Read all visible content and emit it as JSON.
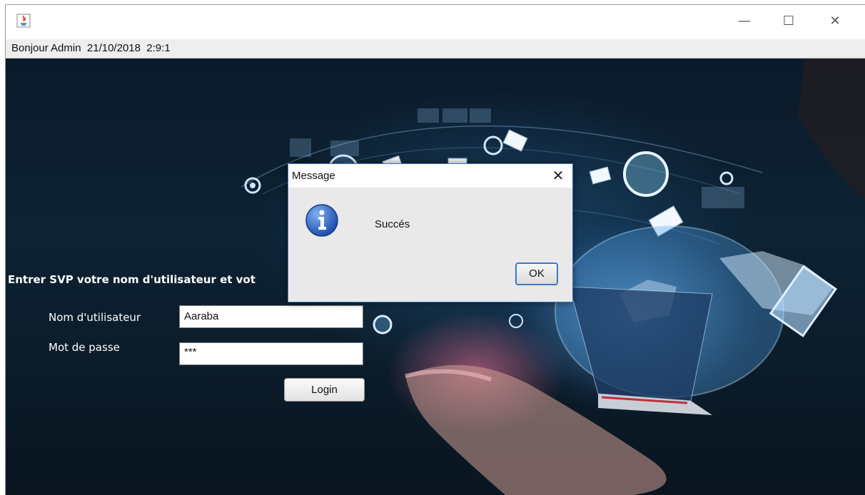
{
  "window": {
    "title": "",
    "controls": {
      "minimize": "—",
      "maximize": "☐",
      "close": "✕"
    },
    "status": "Bonjour Admin  21/10/2018  2:9:1"
  },
  "login": {
    "prompt": "Entrer SVP votre nom d'utilisateur et vot",
    "username_label": "Nom d'utilisateur",
    "username_value": "Aaraba",
    "password_label": "Mot de passe",
    "password_value": "***",
    "login_button": "Login"
  },
  "dialog": {
    "title": "Message",
    "close": "✕",
    "message": "Succés",
    "ok_button": "OK",
    "icon": "info-icon"
  },
  "colors": {
    "dialog_border": "#3c78c8",
    "info_icon_blue": "#2a62c4"
  }
}
